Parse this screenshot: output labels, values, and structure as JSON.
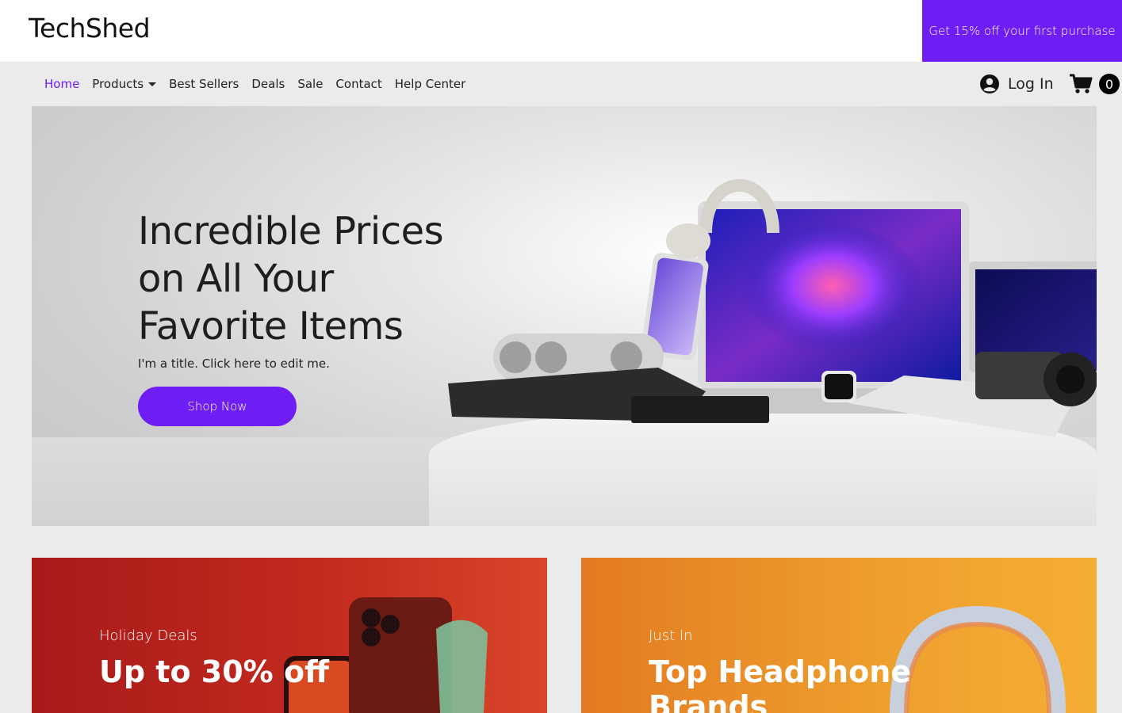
{
  "header": {
    "logo": "TechShed",
    "promo": "Get 15% off your first purchase"
  },
  "nav": {
    "items": [
      {
        "label": "Home",
        "active": true
      },
      {
        "label": "Products",
        "dropdown": true
      },
      {
        "label": "Best Sellers"
      },
      {
        "label": "Deals"
      },
      {
        "label": "Sale"
      },
      {
        "label": "Contact"
      },
      {
        "label": "Help Center"
      }
    ],
    "login_label": "Log In",
    "cart_count": "0"
  },
  "hero": {
    "title": "Incredible Prices on All Your Favorite Items",
    "subtitle": "I'm a title. Click here to edit me.",
    "button_label": "Shop Now"
  },
  "cards": [
    {
      "kicker": "Holiday Deals",
      "title": "Up to 30% off"
    },
    {
      "kicker": "Just In",
      "title": "Top Headphone Brands"
    }
  ],
  "icons": {
    "login": "user-circle-icon",
    "cart": "shopping-cart-icon",
    "dropdown": "caret-down-icon"
  },
  "colors": {
    "accent": "#6f1df5",
    "header_bg": "#ffffff",
    "page_bg": "#ebebeb",
    "card_red": "#c22a1e",
    "card_orange": "#eea02d"
  }
}
